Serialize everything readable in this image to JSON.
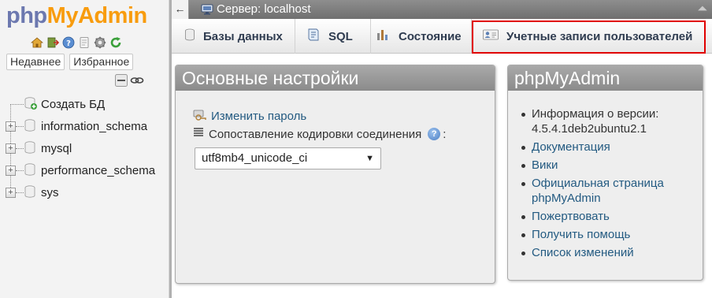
{
  "nav": {
    "logo": {
      "php": "php",
      "my": "My",
      "admin": "Admin"
    },
    "icons": [
      "home-icon",
      "exit-icon",
      "help-icon",
      "docs-icon",
      "settings-icon",
      "reload-icon"
    ],
    "recent_label": "Недавнее",
    "favorites_label": "Избранное",
    "tree": [
      {
        "label": "Создать БД",
        "type": "new"
      },
      {
        "label": "information_schema",
        "type": "db"
      },
      {
        "label": "mysql",
        "type": "db"
      },
      {
        "label": "performance_schema",
        "type": "db"
      },
      {
        "label": "sys",
        "type": "db"
      }
    ]
  },
  "topbar": {
    "back_label": "←",
    "server_label": "Сервер: localhost"
  },
  "tabs": [
    {
      "label": "Базы данных",
      "icon": "database-icon"
    },
    {
      "label": "SQL",
      "icon": "sql-icon"
    },
    {
      "label": "Состояние",
      "icon": "status-icon"
    },
    {
      "label": "Учетные записи пользователей",
      "icon": "users-icon"
    }
  ],
  "settings": {
    "title": "Основные настройки",
    "change_password": "Изменить пароль",
    "collation_label": "Сопоставление кодировки соединения",
    "collation_colon": ":",
    "collation_value": "utf8mb4_unicode_ci"
  },
  "info": {
    "title": "phpMyAdmin",
    "version_text": "Информация о версии: 4.5.4.1deb2ubuntu2.1",
    "links": [
      "Документация",
      "Вики",
      "Официальная страница phpMyAdmin",
      "Пожертвовать",
      "Получить помощь",
      "Список изменений"
    ]
  },
  "colors": {
    "accent_link": "#235a81",
    "highlight": "#e00000",
    "logo_php": "#6c78af",
    "logo_myadmin": "#f89c0e"
  }
}
